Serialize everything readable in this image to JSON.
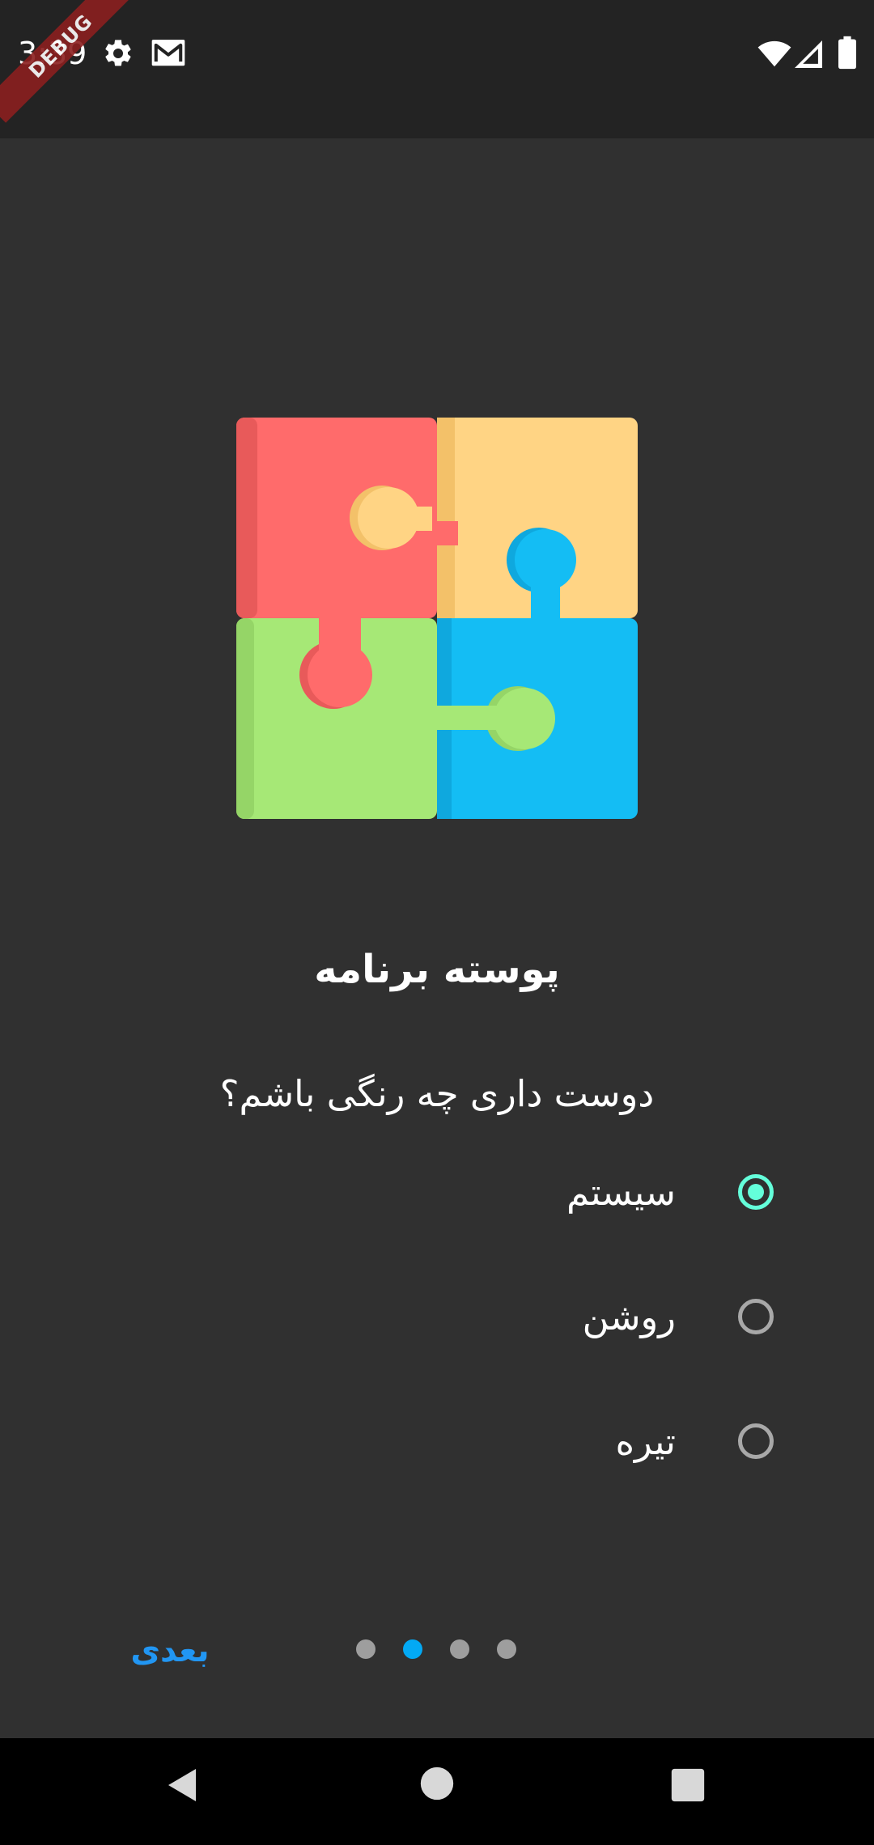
{
  "status_bar": {
    "time": "3:39",
    "debug_label": "DEBUG",
    "icons": [
      "settings-icon",
      "gmail-icon",
      "wifi-icon",
      "signal-icon",
      "battery-icon"
    ]
  },
  "onboarding": {
    "title": "پوسته برنامه",
    "question": "دوست داری چه رنگی باشم؟",
    "options": [
      {
        "label": "سیستم",
        "selected": true
      },
      {
        "label": "روشن",
        "selected": false
      },
      {
        "label": "تیره",
        "selected": false
      }
    ],
    "next_label": "بعدی",
    "page_indicator": {
      "total": 4,
      "current": 2
    }
  },
  "nav_bar": {
    "icons": [
      "back-icon",
      "home-icon",
      "recents-icon"
    ]
  },
  "colors": {
    "background": "#303030",
    "accent_radio": "#64ffda",
    "accent_button": "#2196f3",
    "dot_active": "#03a9f4",
    "dot_inactive": "#9e9e9e"
  }
}
